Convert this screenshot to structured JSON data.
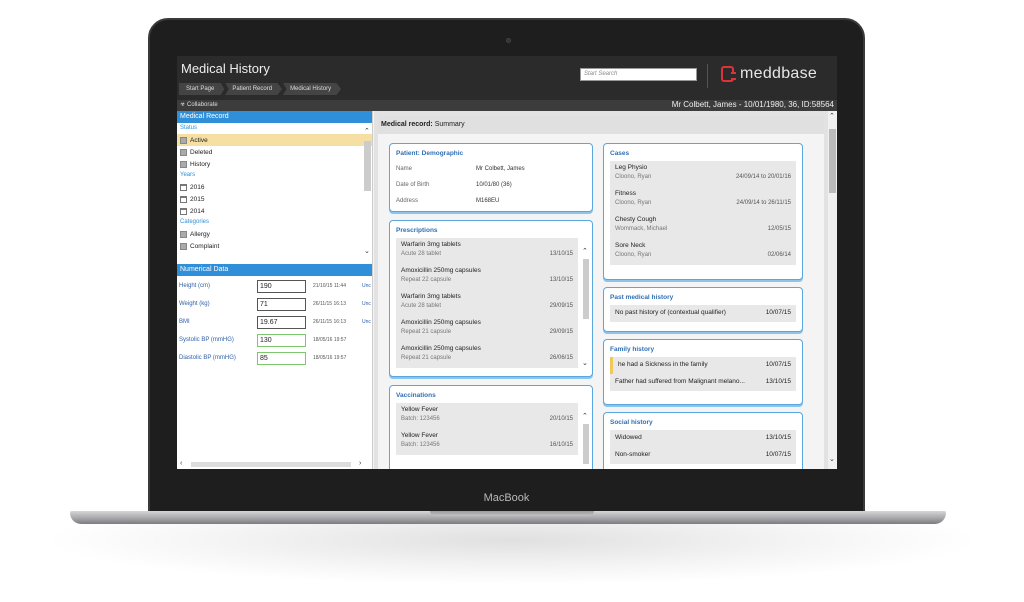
{
  "device": {
    "brand_label": "MacBook"
  },
  "header": {
    "title": "Medical History",
    "breadcrumbs": [
      "Start Page",
      "Patient Record",
      "Medical History"
    ],
    "search_placeholder": "Start Search",
    "logo_text": "meddbase",
    "logo_color": "#e0313a"
  },
  "subbar": {
    "collaborate": "Collaborate",
    "patient_info": "Mr Colbett, James - 10/01/1980, 36, ID:58564"
  },
  "medical_record": {
    "heading": "Medical Record",
    "status_label": "Status",
    "status_items": [
      "Active",
      "Deleted",
      "History"
    ],
    "years_label": "Years",
    "years": [
      "2016",
      "2015",
      "2014"
    ],
    "categories_label": "Categories",
    "categories": [
      "Allergy",
      "Complaint"
    ]
  },
  "numerical": {
    "heading": "Numerical Data",
    "rows": [
      {
        "label": "Height (cm)",
        "value": "190",
        "date": "21/10/15 11:44",
        "unc": "Unc"
      },
      {
        "label": "Weight (kg)",
        "value": "71",
        "date": "26/11/15 16:13",
        "unc": "Unc"
      },
      {
        "label": "BMI",
        "value": "19.67",
        "date": "26/11/15 16:13",
        "unc": "Unc"
      },
      {
        "label": "Systolic BP (mmHG)",
        "value": "130",
        "date": "18/05/16 19:57",
        "unc": ""
      },
      {
        "label": "Diastolic BP (mmHG)",
        "value": "85",
        "date": "18/05/16 19:57",
        "unc": ""
      }
    ]
  },
  "summary": {
    "prefix": "Medical record:",
    "label": "Summary"
  },
  "demographic": {
    "title": "Patient: Demographic",
    "rows": [
      {
        "k": "Name",
        "v": "Mr Colbett, James"
      },
      {
        "k": "Date of Birth",
        "v": "10/01/80 (36)"
      },
      {
        "k": "Address",
        "v": "M168EU"
      }
    ]
  },
  "prescriptions": {
    "title": "Prescriptions",
    "items": [
      {
        "name": "Warfarin 3mg tablets",
        "detail": "Acute   28 tablet",
        "date": "13/10/15"
      },
      {
        "name": "Amoxicillin 250mg capsules",
        "detail": "Repeat   22 capsule",
        "date": "13/10/15"
      },
      {
        "name": "Warfarin 3mg tablets",
        "detail": "Acute   28 tablet",
        "date": "29/09/15"
      },
      {
        "name": "Amoxicillin 250mg capsules",
        "detail": "Repeat   21 capsule",
        "date": "29/09/15"
      },
      {
        "name": "Amoxicillin 250mg capsules",
        "detail": "Repeat   21 capsule",
        "date": "26/06/15"
      }
    ]
  },
  "vaccinations": {
    "title": "Vaccinations",
    "items": [
      {
        "name": "Yellow Fever",
        "detail": "Batch: 123456",
        "date": "20/10/15"
      },
      {
        "name": "Yellow Fever",
        "detail": "Batch: 123456",
        "date": "16/10/15"
      }
    ]
  },
  "cases": {
    "title": "Cases",
    "items": [
      {
        "name": "Leg Physio",
        "person": "Cloono, Ryan",
        "date": "24/09/14 to 20/01/16"
      },
      {
        "name": "Fitness",
        "person": "Cloono, Ryan",
        "date": "24/09/14 to 26/11/15"
      },
      {
        "name": "Chesty Cough",
        "person": "Wommack, Michael",
        "date": "12/05/15"
      },
      {
        "name": "Sore Neck",
        "person": "Cloono, Ryan",
        "date": "02/06/14"
      }
    ]
  },
  "past_medical": {
    "title": "Past medical history",
    "items": [
      {
        "text": "No past history of (contextual qualifier)",
        "date": "10/07/15"
      }
    ]
  },
  "family": {
    "title": "Family history",
    "items": [
      {
        "text": "he had a Sickness in the family",
        "date": "10/07/15"
      },
      {
        "text": "Father had suffered from Malignant melano...",
        "date": "13/10/15"
      }
    ]
  },
  "social": {
    "title": "Social history",
    "items": [
      {
        "text": "Widowed",
        "date": "13/10/15"
      },
      {
        "text": "Non-smoker",
        "date": "10/07/15"
      }
    ]
  }
}
